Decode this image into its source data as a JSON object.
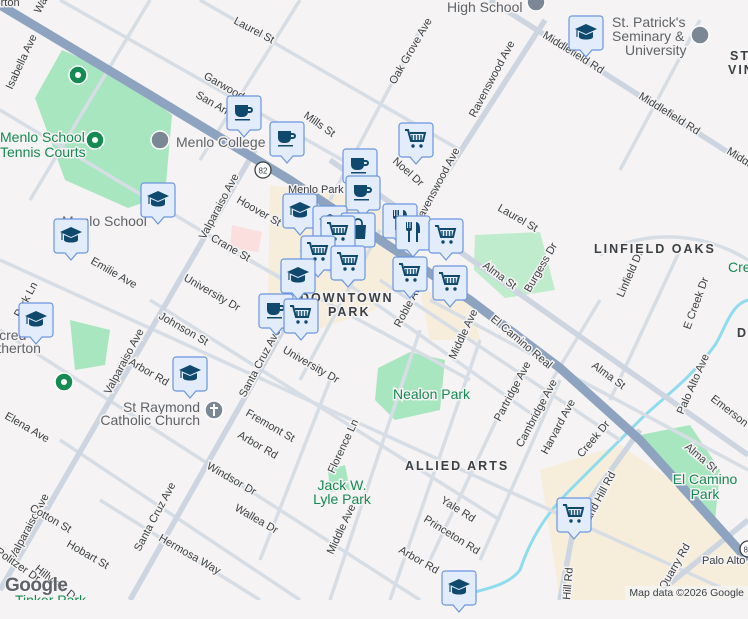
{
  "streets": [
    "Laurel St",
    "Garwood",
    "San Antonio",
    "Mills St",
    "Isabella Ave",
    "Valparaiso Ave",
    "Hoover St",
    "Crane St",
    "University Dr",
    "Park Ln",
    "Emilie Ave",
    "Johnson St",
    "Arbor Rd",
    "Elena Ave",
    "Santa Cruz Ave",
    "Fremont St",
    "Florence Ln",
    "Windsor Dr",
    "Wallea Dr",
    "Cotton St",
    "Hobart St",
    "Hillview Dr",
    "Hermosa Way",
    "Middle Ave",
    "Oak Grove Ave",
    "Ravenswood Ave",
    "Middlefield Rd",
    "Noel Dr",
    "Burgess Dr",
    "Alma St",
    "Linfield Dr",
    "E Creek Dr",
    "El Camino Real",
    "Partridge Ave",
    "Cambridge Ave",
    "Harvard Ave",
    "Creek Dr",
    "Sand Hill Rd",
    "Hill Rd",
    "Yale Rd",
    "Princeton Rd",
    "Quarry Rd",
    "Palo Alto Ave",
    "Emerson St",
    "Roble Ave",
    "Politzer Dr",
    "Palo Alto",
    "Menlo Park",
    "Walsh Rd",
    "Atherton",
    "82"
  ],
  "pois": {
    "tennis": [
      "Menlo School",
      "Tennis Courts"
    ],
    "college": "Menlo College",
    "menlo_school": "Menlo School",
    "church": [
      "St Raymond",
      "Catholic Church"
    ],
    "nealon": "Nealon Park",
    "lyle": [
      "Jack W.",
      "Lyle Park"
    ],
    "elcamino_park": [
      "El Camino",
      "Park"
    ],
    "high_school": "High School",
    "seminary": [
      "St. Patrick's",
      "Seminary &",
      "University"
    ],
    "sacred": [
      "Sacred",
      "Atherton"
    ],
    "tinker": "Tinker Park",
    "creek": "Cre",
    "st_vin": [
      "ST",
      "VIN"
    ]
  },
  "areas": {
    "linfield": "LINFIELD OAKS",
    "allied": "ALLIED ARTS",
    "downtown": [
      "DOWNTOWN",
      "PARK"
    ],
    "d": "D"
  },
  "markers": [
    "coffee",
    "coffee",
    "coffee",
    "coffee",
    "shopping-cart",
    "school",
    "school",
    "school",
    "school",
    "school",
    "school",
    "school",
    "school",
    "restaurant",
    "restaurant",
    "shopping-bag",
    "shopping-cart",
    "shopping-cart",
    "shopping-cart",
    "shopping-cart",
    "shopping-cart",
    "shopping-cart",
    "shopping-cart",
    "school",
    "coffee",
    "shopping-cart"
  ],
  "footer": {
    "attribution": "Map data ©2026 Google",
    "logo": "Google"
  },
  "colors": {
    "marker_bg": "#e3ecfb",
    "marker_border": "#6b95e0",
    "icon": "#0f4a6e",
    "highway": "#8ea3bf",
    "park": "#a8e6c0",
    "commercial": "#f6eedb",
    "water": "#8fdcef"
  }
}
